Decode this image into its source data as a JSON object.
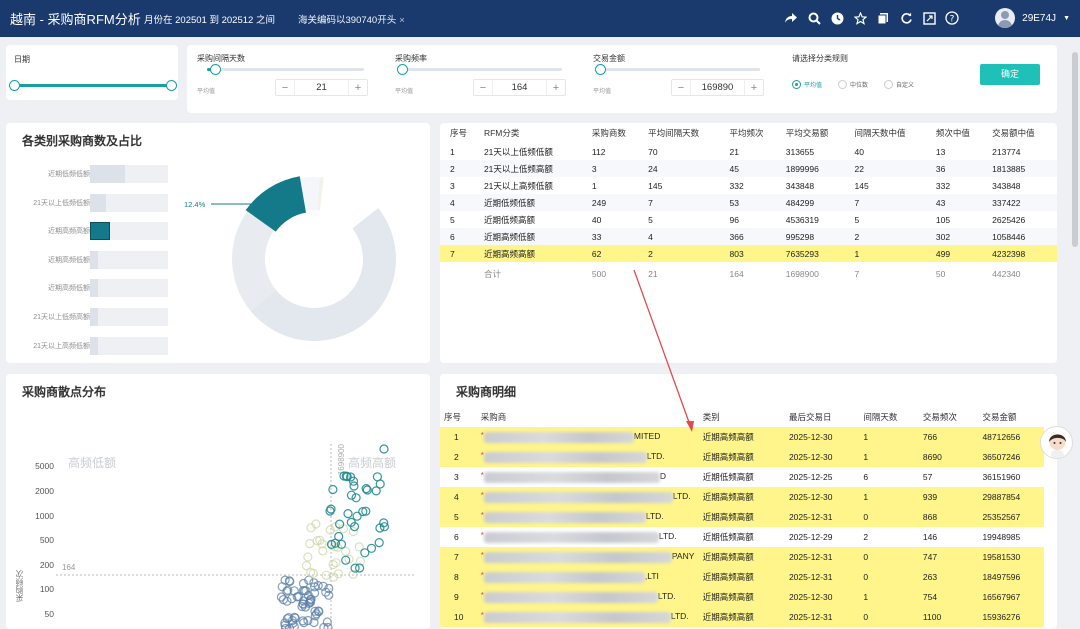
{
  "header": {
    "title": "越南 - 采购商RFM分析",
    "filter_period": "月份在 202501 到 202512 之间",
    "filter_hs": "海关编码以390740开头",
    "user": "29E74J",
    "icons": [
      "share-icon",
      "search-icon",
      "clock-icon",
      "star-icon",
      "copy-icon",
      "refresh-icon",
      "fullscreen-icon",
      "help-icon"
    ]
  },
  "date_filter": {
    "label": "日期"
  },
  "filters": {
    "interval": {
      "label": "采购间隔天数",
      "sub": "平均值",
      "value": "21",
      "level": 0.05
    },
    "frequency": {
      "label": "采购频率",
      "sub": "平均值",
      "value": "164",
      "level": 0.02
    },
    "amount": {
      "label": "交易金额",
      "sub": "平均值",
      "value": "169890",
      "level": 0.02
    },
    "rule": {
      "label": "请选择分类规则",
      "options": [
        "平均值",
        "中位数",
        "自定义"
      ],
      "selected": "平均值"
    },
    "confirm": "确定"
  },
  "category_panel": {
    "title": "各类别采购商数及占比",
    "categories": [
      {
        "label": "近期低频低额",
        "count": 249
      },
      {
        "label": "21天以上低频低额",
        "count": 112
      },
      {
        "label": "近期高频高额",
        "count": 62
      },
      {
        "label": "近期高频低额",
        "count": 33
      },
      {
        "label": "近期高频低额",
        "count": 40
      },
      {
        "label": "21天以上低频高额",
        "count": 3
      },
      {
        "label": "21天以上高频低额",
        "count": 1
      }
    ],
    "pie_label": "12.4%"
  },
  "summary_table": {
    "headers": [
      "序号",
      "RFM分类",
      "采购商数",
      "平均间隔天数",
      "平均频次",
      "平均交易额",
      "间隔天数中值",
      "频次中值",
      "交易额中值"
    ],
    "rows": [
      [
        "1",
        "21天以上低频低额",
        "112",
        "70",
        "21",
        "313655",
        "40",
        "13",
        "213774"
      ],
      [
        "2",
        "21天以上低频高额",
        "3",
        "24",
        "45",
        "1899996",
        "22",
        "36",
        "1813885"
      ],
      [
        "3",
        "21天以上高频低额",
        "1",
        "145",
        "332",
        "343848",
        "145",
        "332",
        "343848"
      ],
      [
        "4",
        "近期低频低额",
        "249",
        "7",
        "53",
        "484299",
        "7",
        "43",
        "337422"
      ],
      [
        "5",
        "近期低频高额",
        "40",
        "5",
        "96",
        "4536319",
        "5",
        "105",
        "2625426"
      ],
      [
        "6",
        "近期高频低额",
        "33",
        "4",
        "366",
        "995298",
        "2",
        "302",
        "1058446"
      ],
      [
        "7",
        "近期高频高额",
        "62",
        "2",
        "803",
        "7635293",
        "1",
        "499",
        "4232398"
      ]
    ],
    "total": [
      "",
      "合计",
      "500",
      "21",
      "164",
      "1698900",
      "7",
      "50",
      "442340"
    ]
  },
  "scatter_panel": {
    "title": "采购商散点分布",
    "yticks": [
      "5000",
      "2000",
      "1000",
      "500",
      "200",
      "100",
      "50"
    ],
    "ref_y": "164",
    "ref_x": "1698900",
    "quad_left": "高频低额",
    "quad_right": "高频高额",
    "ylabel": "采购频次"
  },
  "detail_panel": {
    "title": "采购商明细",
    "headers": [
      "序号",
      "采购商",
      "类别",
      "最后交易日",
      "间隔天数",
      "交易频次",
      "交易金额"
    ],
    "rows": [
      {
        "no": "1",
        "name_tail": "MITED",
        "cat": "近期高频高额",
        "date": "2025-12-30",
        "gap": "1",
        "freq": "766",
        "amt": "48712656",
        "hl": true
      },
      {
        "no": "2",
        "name_tail": "LTD.",
        "cat": "近期高频高额",
        "date": "2025-12-30",
        "gap": "1",
        "freq": "8690",
        "amt": "36507246",
        "hl": true
      },
      {
        "no": "3",
        "name_tail": "D",
        "cat": "近期低频高额",
        "date": "2025-12-25",
        "gap": "6",
        "freq": "57",
        "amt": "36151960",
        "hl": false
      },
      {
        "no": "4",
        "name_tail": "LTD.",
        "cat": "近期高频高额",
        "date": "2025-12-30",
        "gap": "1",
        "freq": "939",
        "amt": "29887854",
        "hl": true
      },
      {
        "no": "5",
        "name_tail": "LTD.",
        "cat": "近期高频高额",
        "date": "2025-12-31",
        "gap": "0",
        "freq": "868",
        "amt": "25352567",
        "hl": true
      },
      {
        "no": "6",
        "name_tail": "LTD.",
        "cat": "近期低频高额",
        "date": "2025-12-29",
        "gap": "2",
        "freq": "146",
        "amt": "19948985",
        "hl": false
      },
      {
        "no": "7",
        "name_tail": "PANY",
        "cat": "近期高频高额",
        "date": "2025-12-31",
        "gap": "0",
        "freq": "747",
        "amt": "19581530",
        "hl": true
      },
      {
        "no": "8",
        "name_tail": ",LTI",
        "cat": "近期高频高额",
        "date": "2025-12-31",
        "gap": "0",
        "freq": "263",
        "amt": "18497596",
        "hl": true
      },
      {
        "no": "9",
        "name_tail": "LTD.",
        "cat": "近期高频高额",
        "date": "2025-12-30",
        "gap": "1",
        "freq": "754",
        "amt": "16567967",
        "hl": true
      },
      {
        "no": "10",
        "name_tail": "LTD.",
        "cat": "近期高频高额",
        "date": "2025-12-31",
        "gap": "0",
        "freq": "1100",
        "amt": "15936276",
        "hl": true
      }
    ]
  },
  "colors": {
    "header": "#1a3a6e",
    "accent": "#18a0a0",
    "highlight": "#fff58a",
    "annotation": "#e04a4a"
  }
}
